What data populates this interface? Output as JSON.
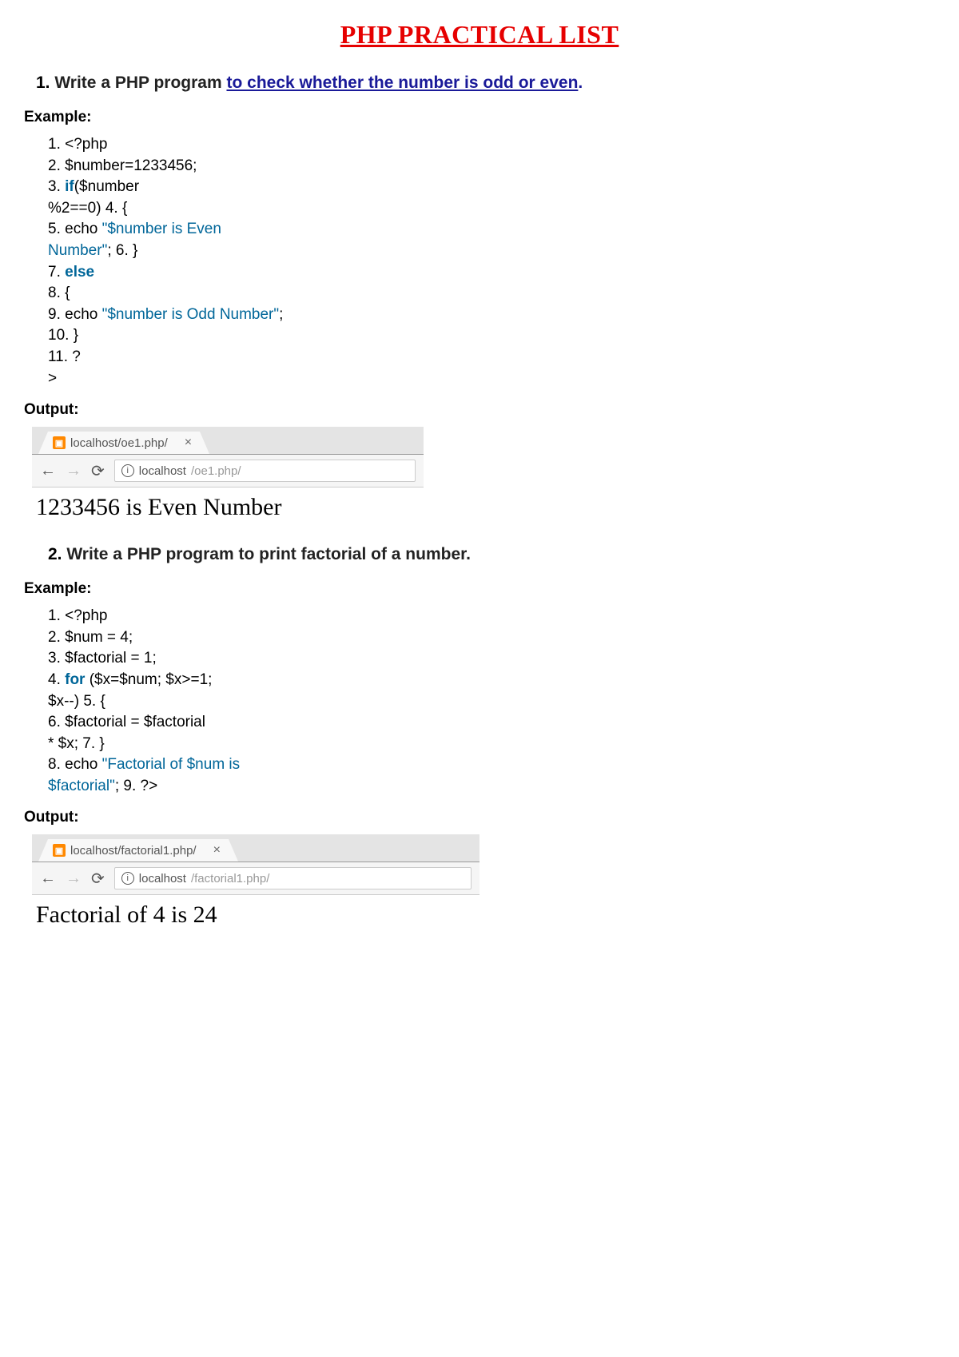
{
  "title": "PHP PRACTICAL LIST",
  "q1": {
    "num": "1.",
    "prefix": "Write a PHP program ",
    "link": "to check whether the number is odd or even",
    "suffix": "."
  },
  "labels": {
    "example": "Example:",
    "output": "Output:"
  },
  "code1": {
    "l1": "1. <?php",
    "l2": "2. $number=1233456;",
    "l3a": "3. ",
    "l3kw": "if",
    "l3b": "($number",
    "l4": "%2==0) 4.  {",
    "l5a": "5.  echo ",
    "l5str": "\"$number is Even",
    "l6a": "Number\"",
    "l6b": "; 6.  }",
    "l7a": "7.  ",
    "l7kw": "else",
    "l8": "8. {",
    "l9a": "9.  echo ",
    "l9str": "\"$number is Odd Number\"",
    "l9b": ";",
    "l10": "10. }",
    "l11": "11. ?",
    "l12": ">"
  },
  "tab1": {
    "favicon": "▣",
    "text": "localhost/oe1.php/",
    "close": "×"
  },
  "addr1": {
    "host": "localhost",
    "path": "/oe1.php/"
  },
  "output1": "1233456 is Even Number",
  "q2": {
    "num": "2.",
    "text": " Write a PHP program to print factorial of a number."
  },
  "code2": {
    "l1": "1. <?php",
    "l2": "2. $num = 4;",
    "l3": "3. $factorial = 1;",
    "l4a": "4. ",
    "l4kw": "for",
    "l4b": " ($x=$num; $x>=1;",
    "l5": "$x--) 5.  {",
    "l6": "6.    $factorial = $factorial",
    "l7": "* $x; 7.  }",
    "l8a": "8. echo ",
    "l8str": "\"Factorial of $num is",
    "l9a": "$factorial\"",
    "l9b": "; 9.  ?>"
  },
  "tab2": {
    "text": "localhost/factorial1.php/",
    "close": "×"
  },
  "addr2": {
    "host": "localhost",
    "path": "/factorial1.php/"
  },
  "output2": "Factorial of 4 is 24"
}
